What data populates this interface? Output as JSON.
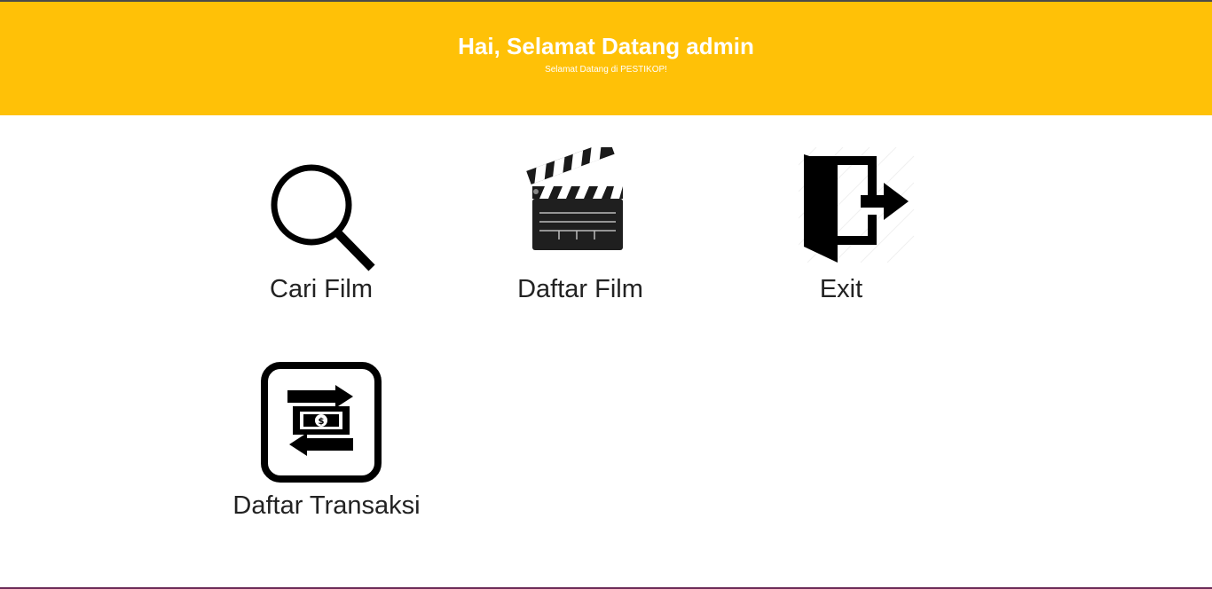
{
  "header": {
    "title": "Hai, Selamat Datang admin",
    "subtitle": "Selamat Datang di PESTIKOP!",
    "background_color": "#ffc107",
    "text_color": "#ffffff"
  },
  "menu": {
    "items": [
      {
        "label": "Cari Film",
        "icon": "magnifier-icon"
      },
      {
        "label": "Daftar Film",
        "icon": "clapperboard-icon"
      },
      {
        "label": "Exit",
        "icon": "exit-door-icon"
      },
      {
        "label": "Daftar Transaksi",
        "icon": "money-transfer-icon"
      }
    ]
  }
}
